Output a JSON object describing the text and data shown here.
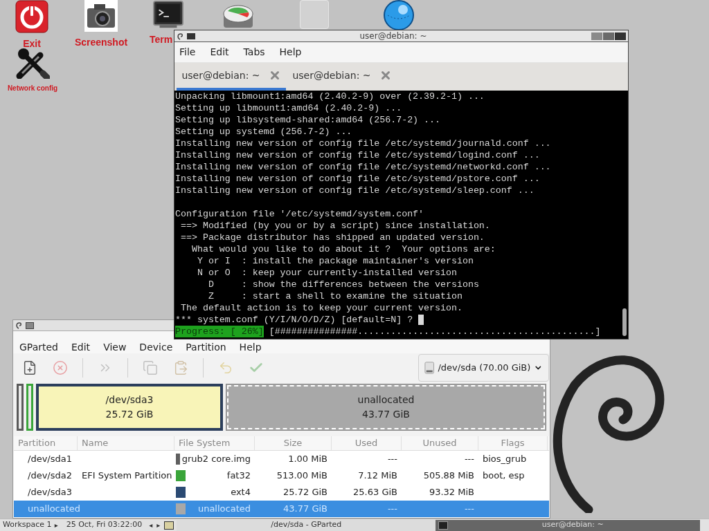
{
  "desktop_icons": [
    {
      "kind": "power",
      "label": "Exit"
    },
    {
      "kind": "camera",
      "label": "Screenshot"
    },
    {
      "kind": "terminal",
      "label": "Term"
    },
    {
      "kind": "disk"
    },
    {
      "kind": "blank"
    },
    {
      "kind": "globe"
    },
    {
      "kind": "tools",
      "label": "Network config"
    }
  ],
  "terminal": {
    "title": "user@debian: ~",
    "menu": [
      "File",
      "Edit",
      "Tabs",
      "Help"
    ],
    "tabs": [
      {
        "label": "user@debian: ~",
        "selected": true
      },
      {
        "label": "user@debian: ~",
        "selected": false
      }
    ],
    "blocks": [
      [
        "Unpacking libmount1:amd64 (2.40.2-9) over (2.39.2-1) ...",
        "Setting up libmount1:amd64 (2.40.2-9) ...",
        "Setting up libsystemd-shared:amd64 (256.7-2) ...",
        "Setting up systemd (256.7-2) ...",
        "Installing new version of config file /etc/systemd/journald.conf ...",
        "Installing new version of config file /etc/systemd/logind.conf ...",
        "Installing new version of config file /etc/systemd/networkd.conf ...",
        "Installing new version of config file /etc/systemd/pstore.conf ...",
        "Installing new version of config file /etc/systemd/sleep.conf ..."
      ],
      [
        "Configuration file '/etc/systemd/system.conf'",
        " ==> Modified (by you or by a script) since installation.",
        " ==> Package distributor has shipped an updated version.",
        "   What would you like to do about it ?  Your options are:",
        "    Y or I  : install the package maintainer's version",
        "    N or O  : keep your currently-installed version",
        "      D     : show the differences between the versions",
        "      Z     : start a shell to examine the situation",
        " The default action is to keep your current version."
      ]
    ],
    "prompt": "*** system.conf (Y/I/N/O/D/Z) [default=N] ? ",
    "progress_label": "Progress: [ 26%]",
    "progress_bar": "[###############...........................................]"
  },
  "gparted": {
    "menu": [
      "GParted",
      "Edit",
      "View",
      "Device",
      "Partition",
      "Help"
    ],
    "toolbar": [
      {
        "kind": "new",
        "disabled": false
      },
      {
        "kind": "delete",
        "disabled": true
      },
      {
        "kind": "resize",
        "disabled": true
      },
      {
        "kind": "copy",
        "disabled": true
      },
      {
        "kind": "paste",
        "disabled": true
      },
      {
        "kind": "undo",
        "disabled": true
      },
      {
        "kind": "apply",
        "disabled": true
      }
    ],
    "device": "/dev/sda (70.00 GiB)",
    "graph": [
      {
        "kind": "small",
        "color": "#5a5a5a",
        "selected": false
      },
      {
        "kind": "small",
        "color": "#3aa53a",
        "selected": false
      },
      {
        "kind": "partition",
        "label": "/dev/sda3",
        "size": "25.72 GiB",
        "color": "#2b3e5c",
        "selected": false
      },
      {
        "kind": "unallocated",
        "label": "unallocated",
        "size": "43.77 GiB",
        "color": "#a8a8a8",
        "selected": true
      }
    ],
    "columns": [
      "Partition",
      "Name",
      "File System",
      "Size",
      "Used",
      "Unused",
      "Flags"
    ],
    "rows": [
      {
        "partition": "/dev/sda1",
        "name": "",
        "fs": "grub2 core.img",
        "color": "#5f5f5f",
        "size": "1.00 MiB",
        "used": "---",
        "unused": "---",
        "flags": "bios_grub",
        "selected": false
      },
      {
        "partition": "/dev/sda2",
        "name": "EFI System Partition",
        "fs": "fat32",
        "color": "#3aa53a",
        "size": "513.00 MiB",
        "used": "7.12 MiB",
        "unused": "505.88 MiB",
        "flags": "boot, esp",
        "selected": false
      },
      {
        "partition": "/dev/sda3",
        "name": "",
        "fs": "ext4",
        "color": "#2b4a73",
        "size": "25.72 GiB",
        "used": "25.63 GiB",
        "unused": "93.32 MiB",
        "flags": "",
        "selected": false
      },
      {
        "partition": "unallocated",
        "name": "",
        "fs": "unallocated",
        "color": "#a8a8a8",
        "size": "43.77 GiB",
        "used": "---",
        "unused": "---",
        "flags": "",
        "selected": true
      }
    ]
  },
  "taskbar": {
    "workspace": "Workspace 1",
    "workspace_arrow": "▸",
    "clock": "25 Oct, Fri 03:22:00",
    "prev": "◂",
    "next": "▸",
    "tasks": [
      {
        "label": "/dev/sda - GParted",
        "selected": false
      },
      {
        "label": "user@debian: ~",
        "selected": true
      }
    ]
  }
}
